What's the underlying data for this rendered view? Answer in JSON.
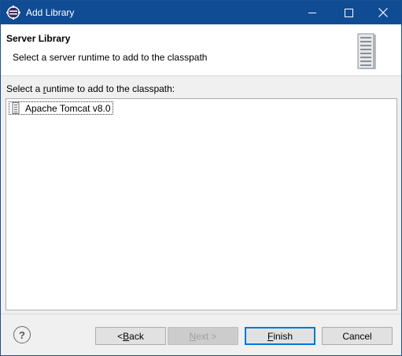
{
  "window": {
    "title": "Add Library",
    "controls": {
      "minimize": "minimize-icon",
      "maximize": "maximize-icon",
      "close": "close-icon"
    }
  },
  "banner": {
    "title": "Server Library",
    "description": "Select a server runtime to add to the classpath",
    "graphic": "server-icon"
  },
  "runtime_list": {
    "label_pre": "Select a ",
    "label_mnemonic": "r",
    "label_post": "untime to add to the classpath:",
    "items": [
      {
        "label": "Apache Tomcat v8.0",
        "icon": "server-runtime-icon",
        "selected": true
      }
    ]
  },
  "footer": {
    "help_glyph": "?",
    "back": {
      "pre": "< ",
      "mnemonic": "B",
      "post": "ack",
      "enabled": true
    },
    "next": {
      "mnemonic": "N",
      "post": "ext >",
      "enabled": false
    },
    "finish": {
      "mnemonic": "F",
      "post": "inish",
      "enabled": true,
      "default": true
    },
    "cancel": {
      "label": "Cancel",
      "enabled": true
    }
  },
  "colors": {
    "titlebar": "#0f4c94",
    "banner_bg": "#ffffff",
    "dialog_bg": "#f0f0f0",
    "default_button_border": "#0078d7"
  }
}
